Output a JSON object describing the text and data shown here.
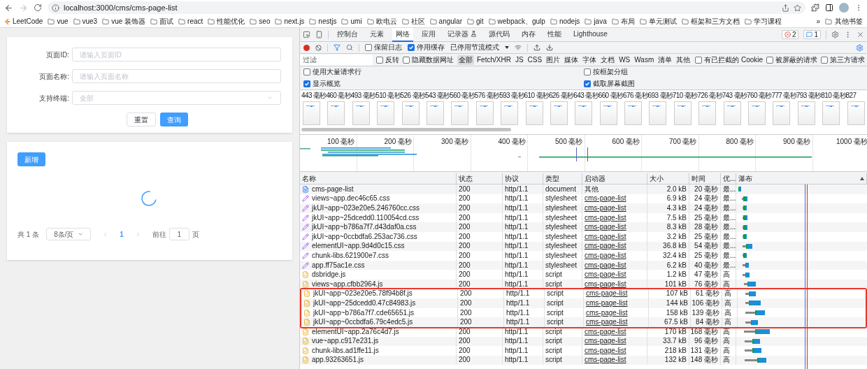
{
  "browser": {
    "address": "localhost:3000/cms/cms-page-list",
    "bookmarks": [
      {
        "label": "LeetCode",
        "kind": "site"
      },
      {
        "label": "vue",
        "kind": "folder"
      },
      {
        "label": "vue3",
        "kind": "folder"
      },
      {
        "label": "vue 装饰器",
        "kind": "folder"
      },
      {
        "label": "面试",
        "kind": "folder"
      },
      {
        "label": "react",
        "kind": "folder"
      },
      {
        "label": "性能优化",
        "kind": "folder"
      },
      {
        "label": "seo",
        "kind": "folder"
      },
      {
        "label": "next.js",
        "kind": "folder"
      },
      {
        "label": "nestjs",
        "kind": "folder"
      },
      {
        "label": "umi",
        "kind": "folder"
      },
      {
        "label": "欧电云",
        "kind": "folder"
      },
      {
        "label": "社区",
        "kind": "folder"
      },
      {
        "label": "angular",
        "kind": "folder"
      },
      {
        "label": "git",
        "kind": "folder"
      },
      {
        "label": "webpack、gulp",
        "kind": "folder"
      },
      {
        "label": "nodejs",
        "kind": "folder"
      },
      {
        "label": "java",
        "kind": "folder"
      },
      {
        "label": "布局",
        "kind": "folder"
      },
      {
        "label": "单元测试",
        "kind": "folder"
      },
      {
        "label": "框架和三方文档",
        "kind": "folder"
      },
      {
        "label": "学习课程",
        "kind": "folder"
      }
    ],
    "overflow": "»",
    "other_bookmarks": "其他书签"
  },
  "page": {
    "form": {
      "fields": [
        {
          "label": "页面ID:",
          "placeholder": "请输入页面ID",
          "kind": "input"
        },
        {
          "label": "页面名称:",
          "placeholder": "请输入页面名称",
          "kind": "input"
        },
        {
          "label": "支持终端:",
          "placeholder": "全部",
          "kind": "select"
        }
      ],
      "buttons": [
        {
          "label": "重置",
          "primary": false
        },
        {
          "label": "查询",
          "primary": true
        }
      ]
    },
    "add_button": "新增",
    "loading": true,
    "pagination": {
      "total": "共 1 条",
      "page_size": "8条/页",
      "pages": [
        {
          "label": "1",
          "selected": true
        }
      ],
      "goto_label": "前往",
      "goto_value": "1",
      "goto_suffix": "页"
    }
  },
  "devtools": {
    "tabs": [
      {
        "label": "控制台",
        "selected": false
      },
      {
        "label": "元素",
        "selected": false
      },
      {
        "label": "网络",
        "selected": true
      },
      {
        "label": "应用",
        "selected": false
      },
      {
        "label": "记录器",
        "selected": false,
        "kind": "flask"
      },
      {
        "label": "源代码",
        "selected": false
      },
      {
        "label": "内存",
        "selected": false
      },
      {
        "label": "性能",
        "selected": false
      },
      {
        "label": "Lighthouse",
        "selected": false
      }
    ],
    "errors": "2",
    "messages": "1",
    "recording": true,
    "toolbar_checkboxes": [
      {
        "label": "保留日志",
        "checked": false
      },
      {
        "label": "停用缓存",
        "checked": true
      }
    ],
    "throttle": "已停用节流模式",
    "filter_placeholder": "过滤",
    "filter_checkboxes": [
      {
        "label": "反转",
        "checked": false
      },
      {
        "label": "隐藏数据网址",
        "checked": false
      }
    ],
    "types": [
      {
        "label": "全部",
        "selected": true
      },
      {
        "label": "Fetch/XHR",
        "selected": false
      },
      {
        "label": "JS",
        "selected": false
      },
      {
        "label": "CSS",
        "selected": false
      },
      {
        "label": "图片",
        "selected": false
      },
      {
        "label": "媒体",
        "selected": false
      },
      {
        "label": "字体",
        "selected": false
      },
      {
        "label": "文档",
        "selected": false
      },
      {
        "label": "WS",
        "selected": false
      },
      {
        "label": "Wasm",
        "selected": false
      },
      {
        "label": "清单",
        "selected": false
      },
      {
        "label": "其他",
        "selected": false
      }
    ],
    "extra_checkboxes": [
      {
        "label": "有已拦截的 Cookie",
        "checked": false
      },
      {
        "label": "被屏蔽的请求",
        "checked": false
      },
      {
        "label": "第三方请求",
        "checked": false
      }
    ],
    "options": [
      {
        "label": "使用大量请求行",
        "checked": false
      },
      {
        "label": "按框架分组",
        "checked": false
      },
      {
        "label": "显示概览",
        "checked": true
      },
      {
        "label": "截取屏幕截图",
        "checked": true
      }
    ],
    "filmstrip": [
      "443 毫秒",
      "460 毫秒",
      "493 毫秒",
      "510 毫秒",
      "526 毫秒",
      "543 毫秒",
      "560 毫秒",
      "576 毫秒",
      "593 毫秒",
      "610 毫秒",
      "626 毫秒",
      "643 毫秒",
      "660 毫秒",
      "676 毫秒",
      "693 毫秒",
      "710 毫秒",
      "726 毫秒",
      "743 毫秒",
      "760 毫秒",
      "777 毫秒",
      "793 毫秒",
      "810 毫秒",
      "827"
    ],
    "overview_ticks": [
      "100 毫秒",
      "200 毫秒",
      "300 毫秒",
      "400 毫秒",
      "500 毫秒",
      "600 毫秒",
      "700 毫秒",
      "800 毫秒",
      "900 毫秒",
      "1000 毫秒"
    ],
    "columns": [
      "名称",
      "状态",
      "协议",
      "类型",
      "启动器",
      "大小",
      "时间",
      "优...",
      "瀑布"
    ],
    "rows": [
      {
        "name": "cms-page-list",
        "status": "200",
        "protocol": "http/1.1",
        "kind": "document",
        "type": "document",
        "initiator": "其他",
        "linked": false,
        "size": "2.0 kB",
        "time": "20 毫秒",
        "priority": "最...",
        "outlined": false
      },
      {
        "name": "views~app.dec46c65.css",
        "status": "200",
        "protocol": "http/1.1",
        "kind": "stylesheet",
        "type": "stylesheet",
        "initiator": "cms-page-list",
        "linked": true,
        "size": "6.9 kB",
        "time": "24 毫秒",
        "priority": "最...",
        "outlined": false
      },
      {
        "name": "jkUI~app~023e20e5.246760cc.css",
        "status": "200",
        "protocol": "http/1.1",
        "kind": "stylesheet",
        "type": "stylesheet",
        "initiator": "cms-page-list",
        "linked": true,
        "size": "4.3 kB",
        "time": "24 毫秒",
        "priority": "最...",
        "outlined": false
      },
      {
        "name": "jkUI~app~25dcedd0.110054cd.css",
        "status": "200",
        "protocol": "http/1.1",
        "kind": "stylesheet",
        "type": "stylesheet",
        "initiator": "cms-page-list",
        "linked": true,
        "size": "7.5 kB",
        "time": "25 毫秒",
        "priority": "最...",
        "outlined": false
      },
      {
        "name": "jkUI~app~b786a7f7.d43daf0a.css",
        "status": "200",
        "protocol": "http/1.1",
        "kind": "stylesheet",
        "type": "stylesheet",
        "initiator": "cms-page-list",
        "linked": true,
        "size": "8.3 kB",
        "time": "28 毫秒",
        "priority": "最...",
        "outlined": false
      },
      {
        "name": "jkUI~app~0ccbdfa6.253ac736.css",
        "status": "200",
        "protocol": "http/1.1",
        "kind": "stylesheet",
        "type": "stylesheet",
        "initiator": "cms-page-list",
        "linked": true,
        "size": "3.2 kB",
        "time": "25 毫秒",
        "priority": "最...",
        "outlined": false
      },
      {
        "name": "elementUI~app.9d4d0c15.css",
        "status": "200",
        "protocol": "http/1.1",
        "kind": "stylesheet",
        "type": "stylesheet",
        "initiator": "cms-page-list",
        "linked": true,
        "size": "36.8 kB",
        "time": "54 毫秒",
        "priority": "最...",
        "outlined": false
      },
      {
        "name": "chunk-libs.621900e7.css",
        "status": "200",
        "protocol": "http/1.1",
        "kind": "stylesheet",
        "type": "stylesheet",
        "initiator": "cms-page-list",
        "linked": true,
        "size": "32.4 kB",
        "time": "25 毫秒",
        "priority": "最...",
        "outlined": false
      },
      {
        "name": "app.ff75ac1e.css",
        "status": "200",
        "protocol": "http/1.1",
        "kind": "stylesheet",
        "type": "stylesheet",
        "initiator": "cms-page-list",
        "linked": true,
        "size": "6.2 kB",
        "time": "40 毫秒",
        "priority": "最...",
        "outlined": false
      },
      {
        "name": "dsbridge.js",
        "status": "200",
        "protocol": "http/1.1",
        "kind": "script",
        "type": "script",
        "initiator": "cms-page-list",
        "linked": true,
        "size": "1.2 kB",
        "time": "47 毫秒",
        "priority": "高",
        "outlined": false
      },
      {
        "name": "views~app.cfbb2964.js",
        "status": "200",
        "protocol": "http/1.1",
        "kind": "script",
        "type": "script",
        "initiator": "cms-page-list",
        "linked": true,
        "size": "101 kB",
        "time": "76 毫秒",
        "priority": "高",
        "outlined": false
      },
      {
        "name": "jkUI~app~023e20e5.78f94b8f.js",
        "status": "200",
        "protocol": "http/1.1",
        "kind": "script",
        "type": "script",
        "initiator": "cms-page-list",
        "linked": true,
        "size": "107 kB",
        "time": "61 毫秒",
        "priority": "高",
        "outlined": true
      },
      {
        "name": "jkUI~app~25dcedd0.47c84983.js",
        "status": "200",
        "protocol": "http/1.1",
        "kind": "script",
        "type": "script",
        "initiator": "cms-page-list",
        "linked": true,
        "size": "144 kB",
        "time": "106 毫秒",
        "priority": "高",
        "outlined": true
      },
      {
        "name": "jkUI~app~b786a7f7.cde65651.js",
        "status": "200",
        "protocol": "http/1.1",
        "kind": "script",
        "type": "script",
        "initiator": "cms-page-list",
        "linked": true,
        "size": "158 kB",
        "time": "139 毫秒",
        "priority": "高",
        "outlined": true
      },
      {
        "name": "jkUI~app~0ccbdfa6.79c4edc5.js",
        "status": "200",
        "protocol": "http/1.1",
        "kind": "script",
        "type": "script",
        "initiator": "cms-page-list",
        "linked": true,
        "size": "67.5 kB",
        "time": "84 毫秒",
        "priority": "高",
        "outlined": true
      },
      {
        "name": "elementUI~app.2a76c4d7.js",
        "status": "200",
        "protocol": "http/1.1",
        "kind": "script",
        "type": "script",
        "initiator": "cms-page-list",
        "linked": true,
        "size": "170 kB",
        "time": "168 毫秒",
        "priority": "高",
        "outlined": false
      },
      {
        "name": "vue~app.c917e231.js",
        "status": "200",
        "protocol": "http/1.1",
        "kind": "script",
        "type": "script",
        "initiator": "cms-page-list",
        "linked": true,
        "size": "33.7 kB",
        "time": "96 毫秒",
        "priority": "高",
        "outlined": false
      },
      {
        "name": "chunk-libs.ad1ffe11.js",
        "status": "200",
        "protocol": "http/1.1",
        "kind": "script",
        "type": "script",
        "initiator": "cms-page-list",
        "linked": true,
        "size": "218 kB",
        "time": "131 毫秒",
        "priority": "高",
        "outlined": false
      },
      {
        "name": "app.93263651.js",
        "status": "200",
        "protocol": "http/1.1",
        "kind": "script",
        "type": "script",
        "initiator": "cms-page-list",
        "linked": true,
        "size": "132 kB",
        "time": "148 毫秒",
        "priority": "高",
        "outlined": false
      }
    ]
  }
}
